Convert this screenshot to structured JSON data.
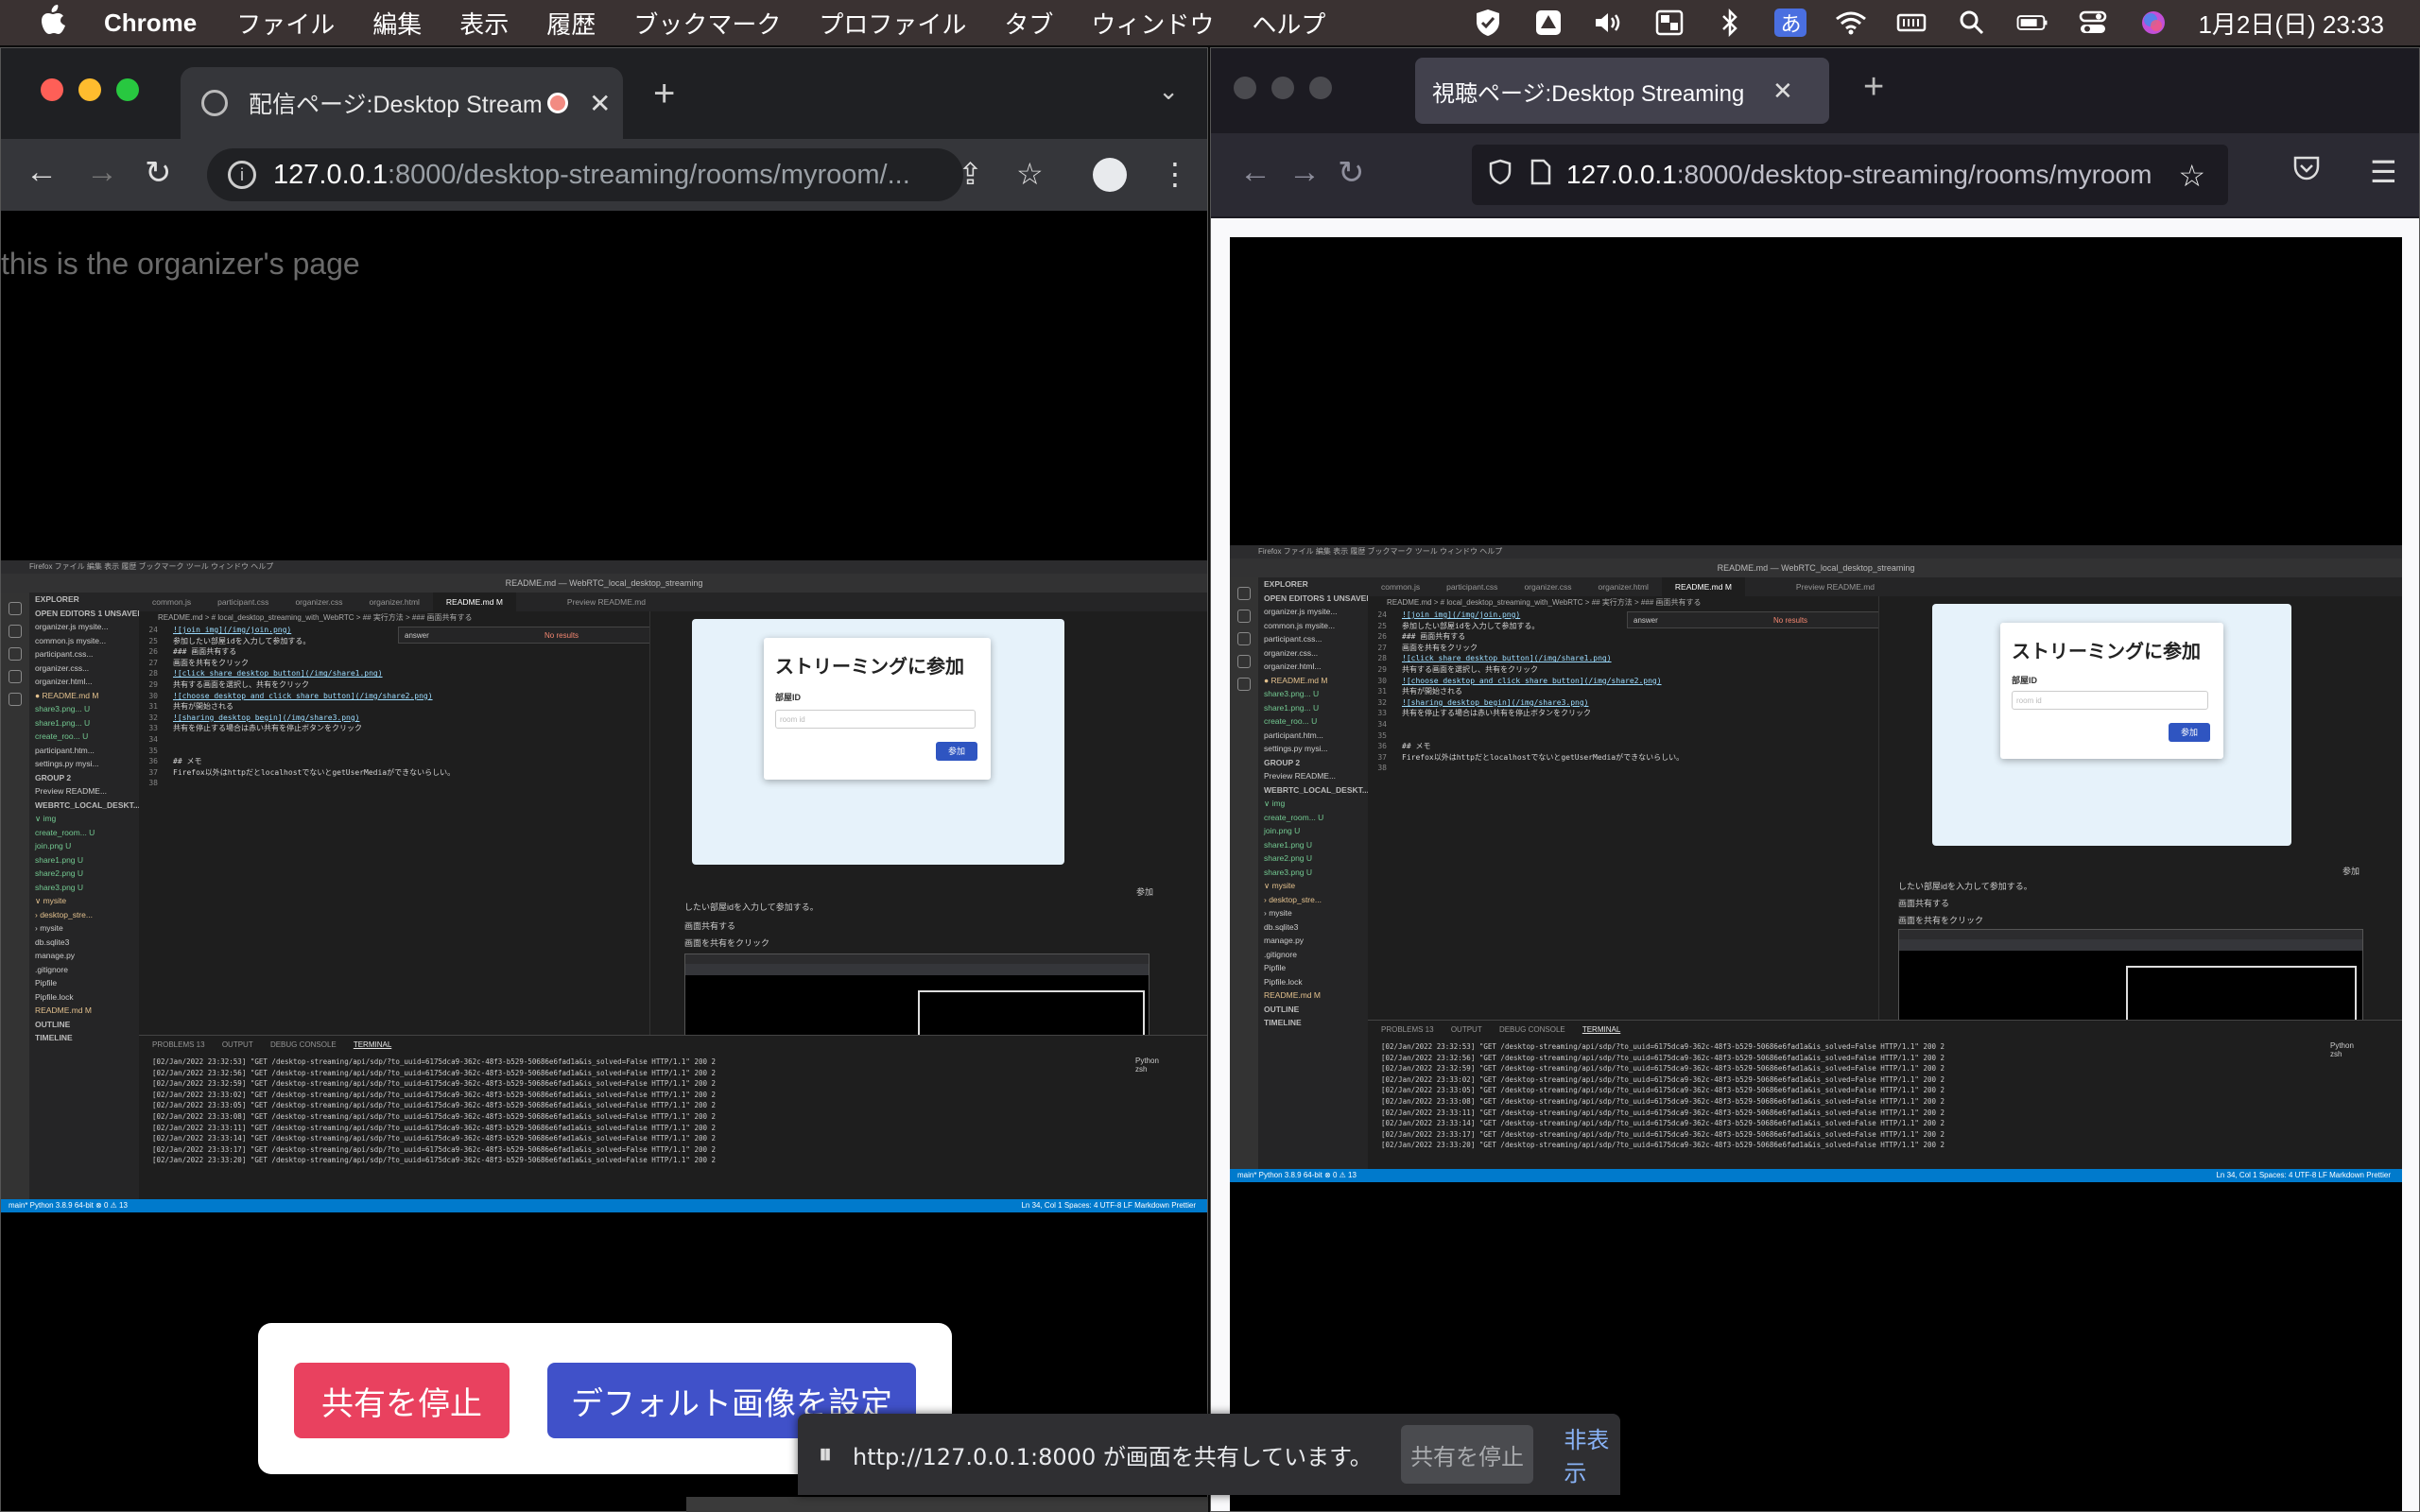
{
  "menubar": {
    "app": "Chrome",
    "items": [
      "ファイル",
      "編集",
      "表示",
      "履歴",
      "ブックマーク",
      "プロファイル",
      "タブ",
      "ウィンドウ",
      "ヘルプ"
    ],
    "ime": "あ",
    "clock": "1月2日(日)  23:33"
  },
  "chrome": {
    "tab_title": "配信ページ:Desktop Streaming",
    "url_host": "127.0.0.1",
    "url_rest": ":8000/desktop-streaming/rooms/myroom/...",
    "page_text": "this is the organizer's page",
    "stop_button": "共有を停止",
    "default_image_button": "デフォルト画像を設定"
  },
  "firefox": {
    "tab_title": "視聴ページ:Desktop Streaming",
    "url_host": "127.0.0.1",
    "url_rest": ":8000/desktop-streaming/rooms/myroom"
  },
  "share_bar": {
    "message": "http://127.0.0.1:8000 が画面を共有しています。",
    "stop_label": "共有を停止",
    "hide_label": "非表示"
  },
  "vscode": {
    "menu": "Firefox  ファイル  編集  表示  履歴  ブックマーク  ツール  ウィンドウ  ヘルプ",
    "title": "README.md — WebRTC_local_desktop_streaming",
    "tabs": [
      "common.js",
      "participant.css",
      "organizer.css",
      "organizer.html",
      "README.md M",
      "Preview README.md"
    ],
    "breadcrumb": "README.md > # local_desktop_streaming_with_WebRTC > ## 実行方法 > ### 画面共有する",
    "find_text": "answer",
    "find_result": "No results",
    "sidebar": [
      {
        "text": "EXPLORER",
        "kind": "head"
      },
      {
        "text": "OPEN EDITORS  1 UNSAVED",
        "kind": "head"
      },
      {
        "text": "  organizer.js mysite...",
        "kind": ""
      },
      {
        "text": "  common.js mysite...",
        "kind": ""
      },
      {
        "text": "  participant.css...",
        "kind": ""
      },
      {
        "text": "  organizer.css...",
        "kind": ""
      },
      {
        "text": "  organizer.html...",
        "kind": ""
      },
      {
        "text": "● README.md          M",
        "kind": "modified"
      },
      {
        "text": "  share3.png...      U",
        "kind": "untracked"
      },
      {
        "text": "  share1.png...      U",
        "kind": "untracked"
      },
      {
        "text": "  create_roo...      U",
        "kind": "untracked"
      },
      {
        "text": "  participant.htm...",
        "kind": ""
      },
      {
        "text": "  settings.py mysi...",
        "kind": ""
      },
      {
        "text": "GROUP 2",
        "kind": "head"
      },
      {
        "text": "  Preview README...",
        "kind": ""
      },
      {
        "text": "WEBRTC_LOCAL_DESKT...",
        "kind": "head"
      },
      {
        "text": "∨ img",
        "kind": "untracked"
      },
      {
        "text": "  create_room...     U",
        "kind": "untracked"
      },
      {
        "text": "  join.png           U",
        "kind": "untracked"
      },
      {
        "text": "  share1.png         U",
        "kind": "untracked"
      },
      {
        "text": "  share2.png         U",
        "kind": "untracked"
      },
      {
        "text": "  share3.png         U",
        "kind": "untracked"
      },
      {
        "text": "∨ mysite",
        "kind": "modified"
      },
      {
        "text": "  › desktop_stre...",
        "kind": "modified"
      },
      {
        "text": "  › mysite",
        "kind": ""
      },
      {
        "text": "  db.sqlite3",
        "kind": ""
      },
      {
        "text": "  manage.py",
        "kind": ""
      },
      {
        "text": ".gitignore",
        "kind": ""
      },
      {
        "text": "Pipfile",
        "kind": ""
      },
      {
        "text": "Pipfile.lock",
        "kind": ""
      },
      {
        "text": "README.md          M",
        "kind": "modified"
      }
    ],
    "editor_lines": [
      {
        "n": "24",
        "t": "![join img](/img/join.png)"
      },
      {
        "n": "25",
        "t": "参加したい部屋idを入力して参加する。"
      },
      {
        "n": "26",
        "t": "### 画面共有する"
      },
      {
        "n": "27",
        "t": "画面を共有をクリック"
      },
      {
        "n": "28",
        "t": "![click share desktop button](/img/share1.png)"
      },
      {
        "n": "29",
        "t": "共有する画面を選択し、共有をクリック"
      },
      {
        "n": "30",
        "t": "![choose  desktop and click share button](/img/share2.png)"
      },
      {
        "n": "31",
        "t": "共有が開始される"
      },
      {
        "n": "32",
        "t": "![sharing desktop begin](/img/share3.png)"
      },
      {
        "n": "33",
        "t": "共有を停止する場合は赤い共有を停止ボタンをクリック"
      },
      {
        "n": "34",
        "t": ""
      },
      {
        "n": "35",
        "t": ""
      },
      {
        "n": "36",
        "t": "## メモ"
      },
      {
        "n": "37",
        "t": "Firefox以外はhttpだとlocalhostでないとgetUserMediaができないらしい。"
      },
      {
        "n": "38",
        "t": ""
      }
    ],
    "preview": {
      "modal_title": "ストリーミングに参加",
      "room_label": "部屋ID",
      "room_placeholder": "room id",
      "join_button": "参加",
      "join_side": "参加",
      "text1": "したい部屋idを入力して参加する。",
      "text2": "画面共有する",
      "text3": "画面を共有をクリック"
    },
    "panel_tabs": [
      "PROBLEMS 13",
      "OUTPUT",
      "DEBUG CONSOLE",
      "TERMINAL"
    ],
    "terminal": [
      "[02/Jan/2022 23:32:53] \"GET /desktop-streaming/api/sdp/?to_uuid=6175dca9-362c-48f3-b529-50686e6fad1a&is_solved=False HTTP/1.1\" 200 2",
      "[02/Jan/2022 23:32:56] \"GET /desktop-streaming/api/sdp/?to_uuid=6175dca9-362c-48f3-b529-50686e6fad1a&is_solved=False HTTP/1.1\" 200 2",
      "[02/Jan/2022 23:32:59] \"GET /desktop-streaming/api/sdp/?to_uuid=6175dca9-362c-48f3-b529-50686e6fad1a&is_solved=False HTTP/1.1\" 200 2",
      "[02/Jan/2022 23:33:02] \"GET /desktop-streaming/api/sdp/?to_uuid=6175dca9-362c-48f3-b529-50686e6fad1a&is_solved=False HTTP/1.1\" 200 2",
      "[02/Jan/2022 23:33:05] \"GET /desktop-streaming/api/sdp/?to_uuid=6175dca9-362c-48f3-b529-50686e6fad1a&is_solved=False HTTP/1.1\" 200 2",
      "[02/Jan/2022 23:33:08] \"GET /desktop-streaming/api/sdp/?to_uuid=6175dca9-362c-48f3-b529-50686e6fad1a&is_solved=False HTTP/1.1\" 200 2",
      "[02/Jan/2022 23:33:11] \"GET /desktop-streaming/api/sdp/?to_uuid=6175dca9-362c-48f3-b529-50686e6fad1a&is_solved=False HTTP/1.1\" 200 2",
      "[02/Jan/2022 23:33:14] \"GET /desktop-streaming/api/sdp/?to_uuid=6175dca9-362c-48f3-b529-50686e6fad1a&is_solved=False HTTP/1.1\" 200 2",
      "[02/Jan/2022 23:33:17] \"GET /desktop-streaming/api/sdp/?to_uuid=6175dca9-362c-48f3-b529-50686e6fad1a&is_solved=False HTTP/1.1\" 200 2",
      "[02/Jan/2022 23:33:20] \"GET /desktop-streaming/api/sdp/?to_uuid=6175dca9-362c-48f3-b529-50686e6fad1a&is_solved=False HTTP/1.1\" 200 2"
    ],
    "terminal_side": [
      "Python",
      "zsh"
    ],
    "outline": "OUTLINE",
    "timeline": "TIMELINE",
    "status_left": "main*   Python 3.8.9 64-bit   ⊗ 0 ⚠ 13",
    "status_right": "Ln 34, Col 1   Spaces: 4   UTF-8   LF   Markdown   Prettier"
  }
}
